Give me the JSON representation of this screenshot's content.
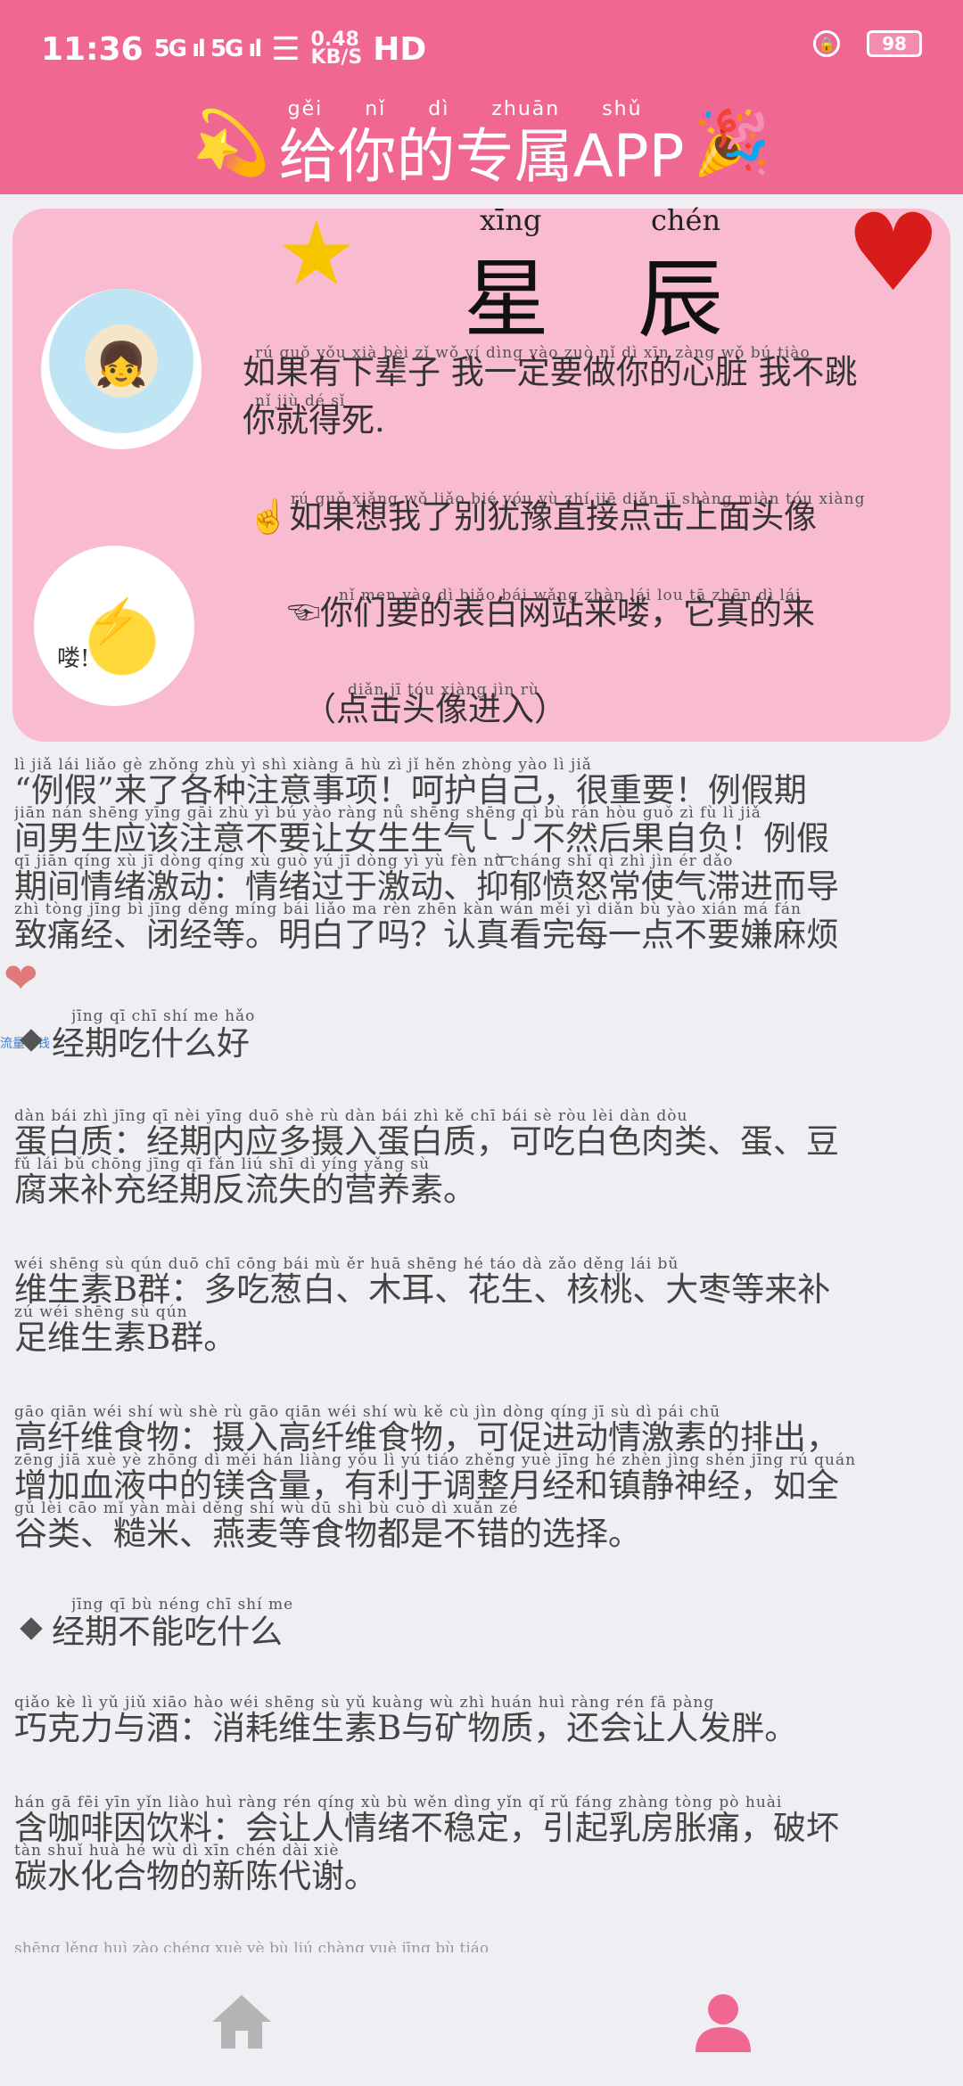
{
  "status_bar": {
    "time": "11:36",
    "signal": "5G ıl  5G ıl",
    "speed_top": "0.48",
    "speed_unit": "KB/S",
    "hd": "HD",
    "battery": "98"
  },
  "header": {
    "title": "给你的专属APP",
    "title_pinyin": "gěi nǐ dì zhuān shǔ",
    "left_deco": "💫",
    "right_deco": "🎉"
  },
  "card": {
    "title_chars": [
      "星",
      "辰"
    ],
    "title_pinyin": [
      "xīng",
      "chén"
    ],
    "line1_pinyin": "rú  guǒ  yǒu  xià  bèi   zǐ      wǒ   yí  dìng  yào  zuò   nǐ   dì   xīn  zàng    wǒ   bú  tiào",
    "line1": "如果有下辈子 我一定要做你的心脏 我不跳",
    "line2_pinyin": "nǐ   jiù   dé   sǐ",
    "line2": "你就得死.",
    "line3_pinyin": "rú  guǒ  xiǎng wǒ   liǎo  bié   yóu   yù   zhí   jiē  diǎn   jī  shàng miàn  tóu  xiàng",
    "line3": "☝如果想我了别犹豫直接点击上面头像",
    "line4_pinyin": "nǐ  men  yào   dì  biǎo  bái  wǎng zhàn  lái   lou              tā  zhēn  dì   lái",
    "line4": "☜你们要的表白网站来喽，它真的来",
    "avatar2_label": "喽!",
    "hint_pinyin": "diǎn   jī   tóu  xiàng  jìn   rù",
    "hint": "（点击头像进入）"
  },
  "content": {
    "intro_pinyin": [
      "lì   jiǎ        lái  liǎo  gè  zhǒng zhù  yì  shì  xiàng        ā   hù   zì    jǐ        hěn zhòng yào        lì   jiǎ",
      "jiān  nán shēng yīng gāi  zhù  yì   bú  yào  ràng  nǚ  shēng shēng qì          bù  rán  hòu  guǒ   zì   fù        lì   jiǎ",
      "qī  jiān qíng  xù  jī  dòng      qíng  xù  guò  yú   jī  dòng   yì   yù  fèn  nù  cháng shǐ   qì  zhì   jìn  ér  dǎo",
      "zhì tòng jīng   bì  jīng děng      míng bái  liǎo  ma      rèn  zhēn kàn wán  měi   yì  diǎn  bù  yào  xián  má  fán"
    ],
    "intro": [
      "“例假”来了各种注意事项！呵护自己，很重要！例假期",
      "间男生应该注意不要让女生生气╰_╯不然后果自负！例假",
      "期间情绪激动：情绪过于激动、抑郁愤怒常使气滞进而导",
      "致痛经、闭经等。明白了吗？认真看完每一点不要嫌麻烦"
    ],
    "heart": "❤",
    "tiny_link": "流量省钱",
    "sec1_pinyin": "jīng   qī   chī  shí   me   hǎo",
    "sec1": "经期吃什么好",
    "p1_pinyin": [
      "dàn  bái  zhì          jīng   qī   nèi  yīng  duō  shè   rù   dàn  bái  zhì           kě   chī  bái   sè   ròu  lèi             dàn           dòu",
      "fǔ   lái  bǔ  chōng  jīng   qī   fǎn   liú  shī   dì  yíng yǎng  sù"
    ],
    "p1": [
      "蛋白质：经期内应多摄入蛋白质，可吃白色肉类、蛋、豆",
      "腐来补充经期反流失的营养素。"
    ],
    "p2_pinyin": [
      "wéi shēng  sù   qún          duō  chī  cōng  bái        mù   ěr         huā shēng       hé   táo        dà  zǎo  děng  lái   bǔ",
      "zú  wéi shēng  sù   qún"
    ],
    "p2": [
      "维生素B群：多吃葱白、木耳、花生、核桃、大枣等来补",
      "足维生素B群。"
    ],
    "p3_pinyin": [
      "gāo  qiān  wéi   shí   wù         shè   rù  gāo  qiān  wéi   shí   wù          kě   cù   jìn  dòng  qíng   jī   sù   dì   pái  chū",
      "zēng  jiā   xuè   yè  zhōng  dì   měi  hán liàng      yǒu   lì   yú  tiáo zhěng yuè  jīng  hé  zhèn  jìng shén  jīng         rú  quán",
      "gǔ   lèi       cāo   mǐ       yàn  mài  děng  shí   wù   dū   shì   bù   cuò   dì  xuǎn  zé"
    ],
    "p3": [
      "高纤维食物：摄入高纤维食物，可促进动情激素的排出，",
      "增加血液中的镁含量，有利于调整月经和镇静神经，如全",
      "谷类、糙米、燕麦等食物都是不错的选择。"
    ],
    "sec2_pinyin": "jīng   qī   bù  néng  chī  shí   me",
    "sec2": "经期不能吃什么",
    "p4_pinyin": "qiǎo  kè   lì   yǔ   jiǔ         xiāo  hào  wéi shēng  sù       yǔ  kuàng  wù   zhì          huán  huì  ràng  rén   fā  pàng",
    "p4": "巧克力与酒：消耗维生素B与矿物质，还会让人发胖。",
    "p5_pinyin": [
      "hán   gā   fēi  yīn   yǐn  liào         huì  ràng  rén  qíng  xù   bù  wěn  dìng        yǐn   qǐ   rǔ  fáng zhàng tòng         pò  huài",
      "tàn  shuǐ  huà   hé   wù   dì   xīn  chén  dài   xiè"
    ],
    "p5": [
      "含咖啡因饮料：会让人情绪不稳定，引起乳房胀痛，破坏",
      "碳水化合物的新陈代谢。"
    ],
    "fade_pinyin": "shēng  lěng           huì   zào  chéng  xuè     yè     bù    liú  chàng          yuè   jīng   bù   tiáo"
  },
  "nav": {
    "home": "home-icon",
    "me": "person-icon",
    "active_color": "#f06792",
    "inactive_color": "#b5b5b5"
  }
}
